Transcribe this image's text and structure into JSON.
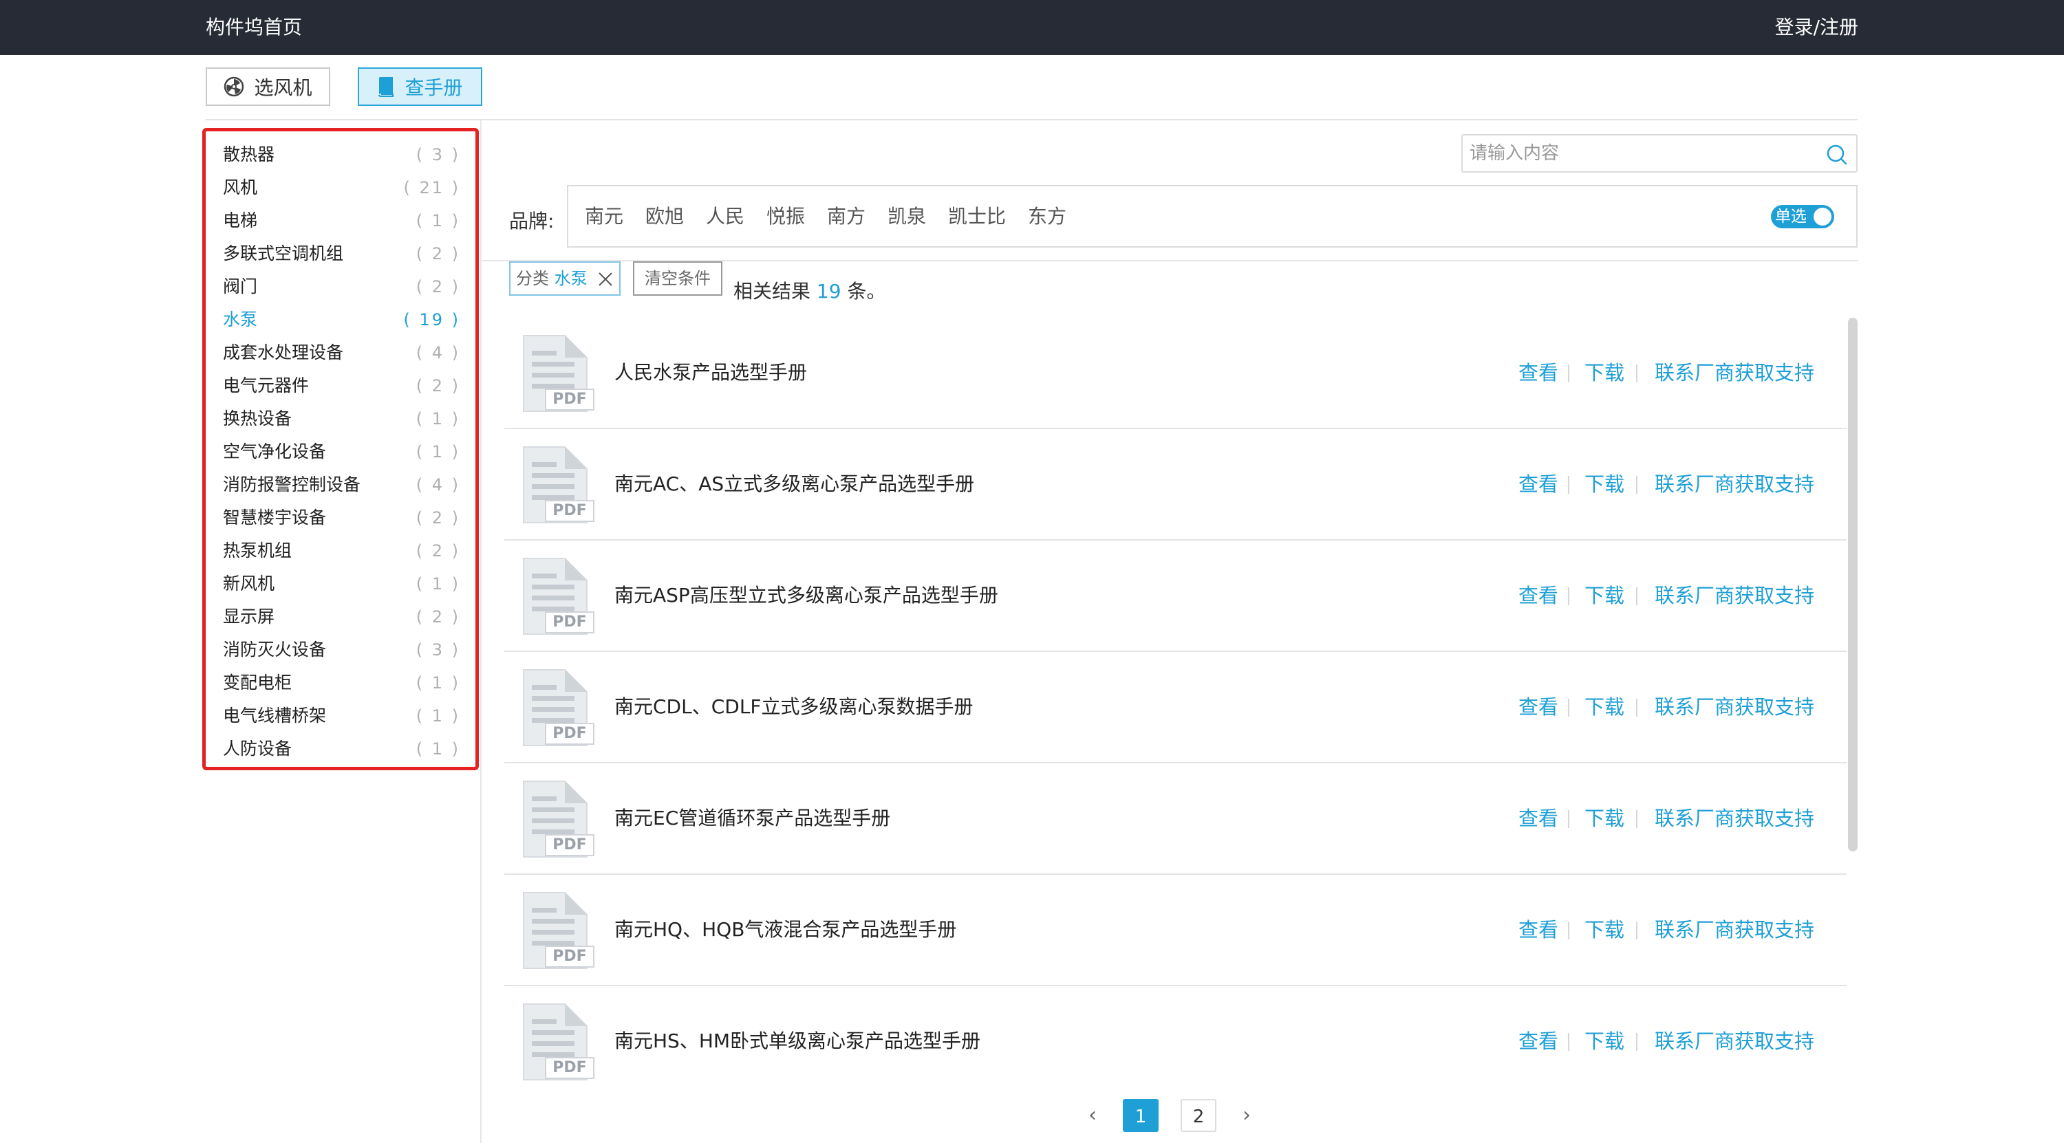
{
  "header": {
    "brand": "构件坞首页",
    "login": "登录/注册"
  },
  "modes": {
    "fan_selector": "选风机",
    "manual_lookup": "查手册"
  },
  "categories": [
    {
      "name": "散热器",
      "count": "( 3 )"
    },
    {
      "name": "风机",
      "count": "( 21 )"
    },
    {
      "name": "电梯",
      "count": "( 1 )"
    },
    {
      "name": "多联式空调机组",
      "count": "( 2 )"
    },
    {
      "name": "阀门",
      "count": "( 2 )"
    },
    {
      "name": "水泵",
      "count": "( 19 )",
      "active": true
    },
    {
      "name": "成套水处理设备",
      "count": "( 4 )"
    },
    {
      "name": "电气元器件",
      "count": "( 2 )"
    },
    {
      "name": "换热设备",
      "count": "( 1 )"
    },
    {
      "name": "空气净化设备",
      "count": "( 1 )"
    },
    {
      "name": "消防报警控制设备",
      "count": "( 4 )"
    },
    {
      "name": "智慧楼宇设备",
      "count": "( 2 )"
    },
    {
      "name": "热泵机组",
      "count": "( 2 )"
    },
    {
      "name": "新风机",
      "count": "( 1 )"
    },
    {
      "name": "显示屏",
      "count": "( 2 )"
    },
    {
      "name": "消防灭火设备",
      "count": "( 3 )"
    },
    {
      "name": "变配电柜",
      "count": "( 1 )"
    },
    {
      "name": "电气线槽桥架",
      "count": "( 1 )"
    },
    {
      "name": "人防设备",
      "count": "( 1 )"
    }
  ],
  "search": {
    "placeholder": "请输入内容",
    "value": ""
  },
  "brand_filter": {
    "label": "品牌:",
    "options": [
      "南元",
      "欧旭",
      "人民",
      "悦振",
      "南方",
      "凯泉",
      "凯士比",
      "东方"
    ],
    "mode_toggle": "单选"
  },
  "active_filter": {
    "key": "分类",
    "value": "水泵",
    "clear_label": "清空条件"
  },
  "result": {
    "prefix": "相关结果",
    "count": "19",
    "suffix": "条。"
  },
  "manuals": [
    {
      "title": "人民水泵产品选型手册"
    },
    {
      "title": "南元AC、AS立式多级离心泵产品选型手册"
    },
    {
      "title": "南元ASP高压型立式多级离心泵产品选型手册"
    },
    {
      "title": "南元CDL、CDLF立式多级离心泵数据手册"
    },
    {
      "title": "南元EC管道循环泵产品选型手册"
    },
    {
      "title": "南元HQ、HQB气液混合泵产品选型手册"
    },
    {
      "title": "南元HS、HM卧式单级离心泵产品选型手册"
    }
  ],
  "row_actions": {
    "view": "查看",
    "download": "下载",
    "contact": "联系厂商获取支持"
  },
  "pdf_badge": "PDF",
  "pagination": {
    "prev": "‹",
    "next": "›",
    "pages": [
      "1",
      "2"
    ],
    "current": "1"
  }
}
